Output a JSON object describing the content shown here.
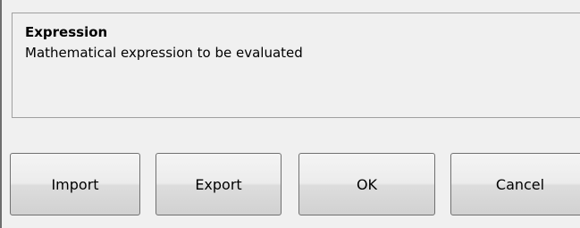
{
  "help": {
    "title": "Expression",
    "description": "Mathematical expression to be evaluated"
  },
  "buttons": {
    "import": "Import",
    "export": "Export",
    "ok": "OK",
    "cancel": "Cancel"
  }
}
